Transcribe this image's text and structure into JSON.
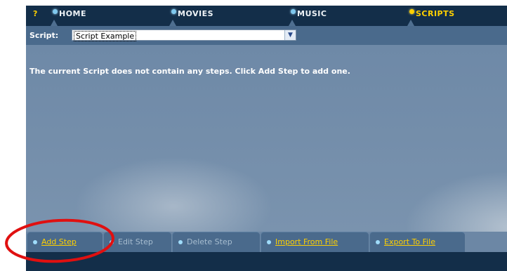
{
  "nav": {
    "help": "?",
    "items": [
      {
        "label": "HOME",
        "active": false
      },
      {
        "label": "MOVIES",
        "active": false
      },
      {
        "label": "MUSIC",
        "active": false
      },
      {
        "label": "SCRIPTS",
        "active": true
      }
    ]
  },
  "script": {
    "label": "Script:",
    "selected": "Script Example"
  },
  "message": "The current Script does not contain any steps. Click Add Step to add one.",
  "tabs": [
    {
      "label": "Add Step",
      "enabled": true
    },
    {
      "label": "Edit Step",
      "enabled": false
    },
    {
      "label": "Delete Step",
      "enabled": false
    },
    {
      "label": "Import From File",
      "enabled": true
    },
    {
      "label": "Export To File",
      "enabled": true
    }
  ],
  "colors": {
    "accent": "#ffd000",
    "nav_bg": "#132e49",
    "bar_bg": "#4a6a8c",
    "annotation": "#e01010"
  }
}
